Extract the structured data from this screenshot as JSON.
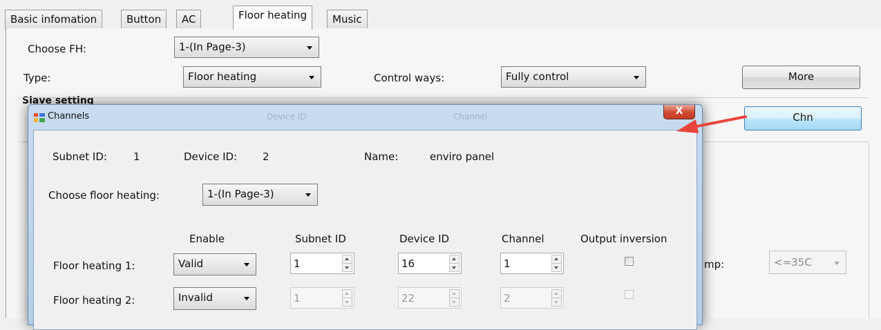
{
  "tabs": [
    "Basic infomation",
    "Button",
    "AC",
    "Floor heating",
    "Music"
  ],
  "main": {
    "choose_fh_label": "Choose FH:",
    "choose_fh_value": "1-(In Page-3)",
    "type_label": "Type:",
    "type_value": "Floor heating",
    "control_ways_label": "Control ways:",
    "control_ways_value": "Fully control",
    "more_button": "More",
    "slave_setting_label": "Slave setting",
    "chn_button": "Chn",
    "temp_label_partial": "mp:",
    "temp_value": "<=35C"
  },
  "dialog": {
    "title": "Channels",
    "close_label": "X",
    "ghost_labels": [
      "Device ID",
      "Channel"
    ],
    "subnet_id_label": "Subnet ID:",
    "subnet_id_value": "1",
    "device_id_label": "Device ID:",
    "device_id_value": "2",
    "name_label": "Name:",
    "name_value": "enviro panel",
    "choose_floor_heating_label": "Choose floor heating:",
    "choose_floor_heating_value": "1-(In Page-3)",
    "columns": [
      "Enable",
      "Subnet ID",
      "Device ID",
      "Channel",
      "Output inversion"
    ],
    "rows": [
      {
        "label": "Floor heating  1:",
        "enable": "Valid",
        "subnet_id": "1",
        "device_id": "16",
        "channel": "1",
        "output_inversion": false
      },
      {
        "label": "Floor heating  2:",
        "enable": "Invalid",
        "subnet_id": "1",
        "device_id": "22",
        "channel": "2",
        "output_inversion": false
      }
    ]
  },
  "colors": {
    "annotation_arrow": "#e8453c",
    "close_button": "#c8452f"
  }
}
